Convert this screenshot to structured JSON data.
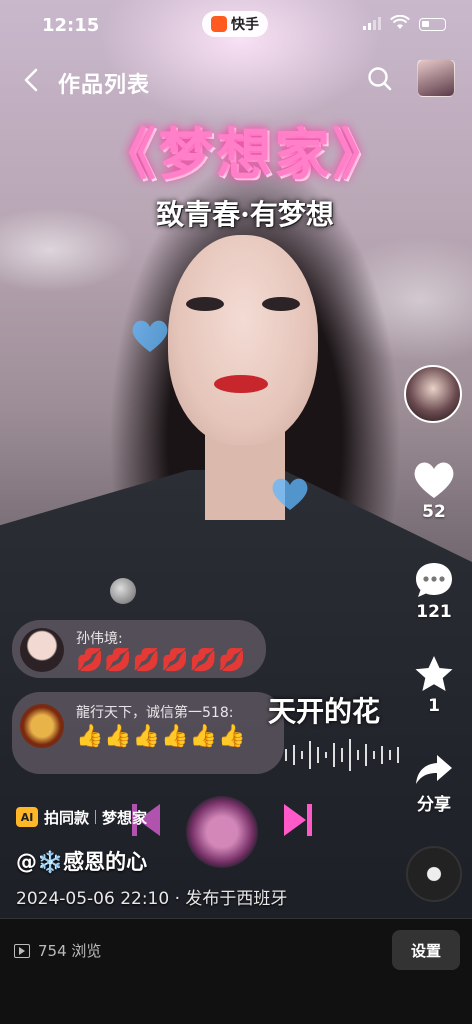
{
  "status_bar": {
    "time": "12:15",
    "app_name": "快手"
  },
  "header": {
    "title": "作品列表"
  },
  "overlay": {
    "song_title": "《梦想家》",
    "subtitle": "致青春·有梦想",
    "lyric": "天开的花"
  },
  "right_rail": {
    "likes": "52",
    "comments": "121",
    "favorites": "1",
    "share_label": "分享"
  },
  "comments": [
    {
      "name": "孙伟境:",
      "content": "💋💋💋💋💋💋"
    },
    {
      "name": "龍行天下，诚信第一518:",
      "content": "👍👍👍👍👍👍"
    }
  ],
  "same_style": {
    "ai_badge": "AI",
    "label": "拍同款",
    "song": "梦想家"
  },
  "author": {
    "name": "@❄️感恩的心"
  },
  "meta": {
    "date_place": "2024-05-06 22:10 · 发布于西班牙"
  },
  "bottom_bar": {
    "views": "754 浏览",
    "settings_label": "设置"
  }
}
